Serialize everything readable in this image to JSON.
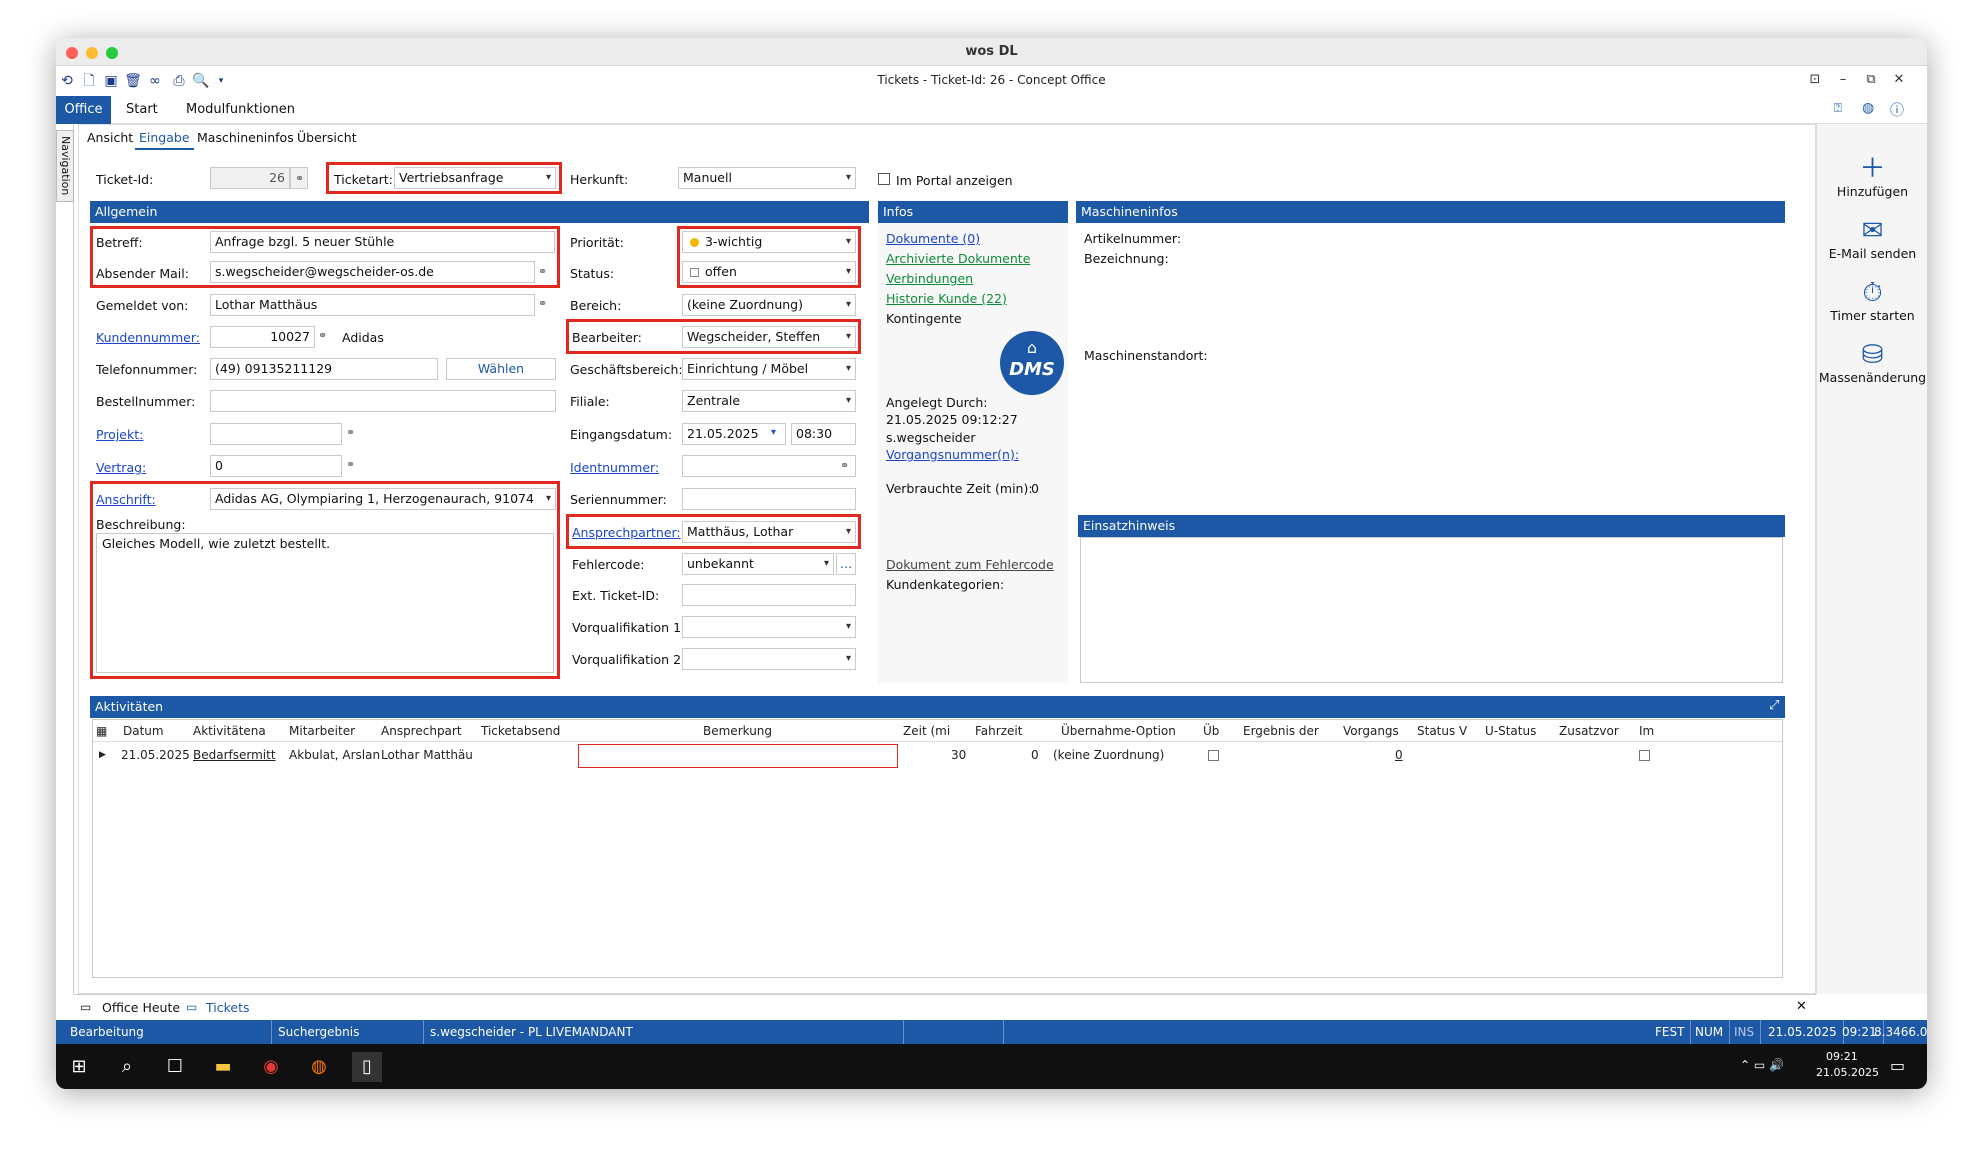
{
  "mac": {
    "title": "wos DL"
  },
  "app": {
    "title": "Tickets - Ticket-Id: 26 - Concept Office"
  },
  "tabs": [
    "Office",
    "Start",
    "Modulfunktionen"
  ],
  "nav_label": "Navigation",
  "subtabs": [
    "Ansicht",
    "Eingabe",
    "Maschineninfos",
    "Übersicht"
  ],
  "header": {
    "ticket_id_label": "Ticket-Id:",
    "ticket_id": "26",
    "ticketart_label": "Ticketart:",
    "ticketart": "Vertriebsanfrage",
    "herkunft_label": "Herkunft:",
    "herkunft": "Manuell",
    "portal_label": "Im Portal anzeigen"
  },
  "allgemein": {
    "title": "Allgemein",
    "betreff_label": "Betreff:",
    "betreff": "Anfrage bzgl. 5 neuer Stühle",
    "absender_label": "Absender Mail:",
    "absender": "s.wegscheider@wegscheider-os.de",
    "gemeldet_label": "Gemeldet von:",
    "gemeldet": "Lothar Matthäus",
    "kunde_label": "Kundennummer:",
    "kunde": "10027",
    "kunde_name": "Adidas",
    "telefon_label": "Telefonnummer:",
    "telefon": "(49) 09135211129",
    "waehlen": "Wählen",
    "bestell_label": "Bestellnummer:",
    "bestell": "",
    "projekt_label": "Projekt:",
    "projekt": "",
    "vertrag_label": "Vertrag:",
    "vertrag": "0",
    "anschrift_label": "Anschrift:",
    "anschrift": "Adidas AG, Olympiaring 1, Herzogenaurach, 91074",
    "beschreibung_label": "Beschreibung:",
    "beschreibung": "Gleiches Modell, wie zuletzt bestellt.",
    "prio_label": "Priorität:",
    "prio": "3-wichtig",
    "prio_color": "#f2b705",
    "status_label": "Status:",
    "status": "offen",
    "bereich_label": "Bereich:",
    "bereich": "(keine Zuordnung)",
    "bearbeiter_label": "Bearbeiter:",
    "bearbeiter": "Wegscheider, Steffen",
    "gb_label": "Geschäftsbereich:",
    "gb": "Einrichtung / Möbel",
    "filiale_label": "Filiale:",
    "filiale": "Zentrale",
    "eingang_label": "Eingangsdatum:",
    "eingang_date": "21.05.2025",
    "eingang_time": "08:30",
    "ident_label": "Identnummer:",
    "serien_label": "Seriennummer:",
    "ansprech_label": "Ansprechpartner:",
    "ansprech": "Matthäus, Lothar",
    "fehler_label": "Fehlercode:",
    "fehler": "unbekannt",
    "ext_label": "Ext. Ticket-ID:",
    "vq1_label": "Vorqualifikation 1:",
    "vq2_label": "Vorqualifikation 2:"
  },
  "infos": {
    "title": "Infos",
    "links": [
      "Dokumente (0)",
      "Archivierte Dokumente",
      "Verbindungen",
      "Historie Kunde (22)"
    ],
    "kontingente": "Kontingente",
    "dms": "DMS",
    "angelegt_label": "Angelegt Durch:",
    "angelegt_date": "21.05.2025 09:12:27",
    "angelegt_user": "s.wegscheider",
    "vorgang": "Vorgangsnummer(n):",
    "zeit_label": "Verbrauchte Zeit (min):",
    "zeit": "0",
    "doc_fehler": "Dokument zum Fehlercode",
    "kundenkat": "Kundenkategorien:"
  },
  "maschine": {
    "title": "Maschineninfos",
    "artikel": "Artikelnummer:",
    "bezeichnung": "Bezeichnung:",
    "standort": "Maschinenstandort:",
    "einsatz": "Einsatzhinweis"
  },
  "aktivitaeten": {
    "title": "Aktivitäten",
    "columns": [
      "Datum",
      "Aktivitätena",
      "Mitarbeiter",
      "Ansprechpart",
      "Ticketabsend",
      "Bemerkung",
      "Zeit (mi",
      "Fahrzeit",
      "Übernahme-Option",
      "Üb",
      "Ergebnis der",
      "Vorgangs",
      "Status V",
      "U-Status",
      "Zusatzvor",
      "Im"
    ],
    "row": {
      "datum": "21.05.2025",
      "aktivitaet": "Bedarfsermitt",
      "mitarbeiter": "Akbulat, Arslan",
      "ansprech": "Lothar Matthäu",
      "zeit": "30",
      "fahrzeit": "0",
      "uebernahme": "(keine Zuordnung)",
      "vorgang": "0"
    }
  },
  "ribbon": [
    "Hinzufügen",
    "E-Mail senden",
    "Timer starten",
    "Massenänderung"
  ],
  "bottomtabs": [
    "Office Heute",
    "Tickets"
  ],
  "status": {
    "mode": "Bearbeitung",
    "search": "Suchergebnis",
    "user": "s.wegscheider - PL LIVEMANDANT",
    "fest": "FEST",
    "num": "NUM",
    "ins": "INS",
    "date": "21.05.2025",
    "time": "09:21",
    "version": "8.3466.0"
  },
  "taskbar": {
    "time": "09:21",
    "date": "21.05.2025"
  }
}
